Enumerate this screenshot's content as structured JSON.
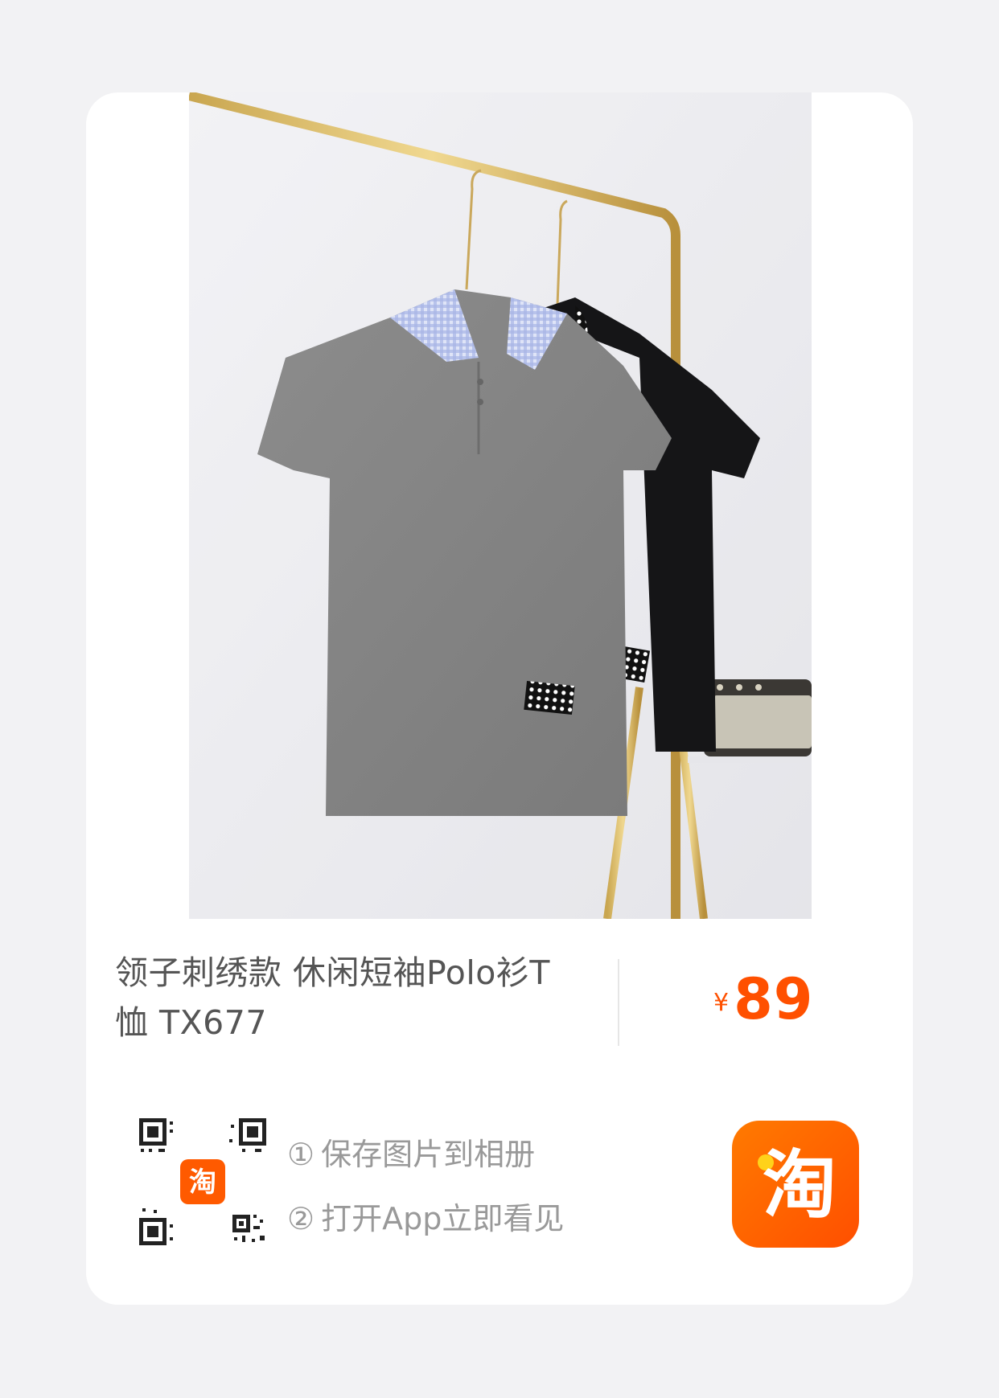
{
  "product": {
    "title": "领子刺绣款 休闲短袖Polo衫T恤 TX677",
    "image_alt": "grey and black polo shirts on hanger"
  },
  "price": {
    "currency": "¥",
    "amount": "89"
  },
  "instructions": {
    "step1_num": "①",
    "step1_text": "保存图片到相册",
    "step2_num": "②",
    "step2_text": "打开App立即看见"
  },
  "qr_badge": {
    "text": "淘"
  },
  "taobao_logo": {
    "text": "淘"
  },
  "colors": {
    "accent": "#ff5000",
    "logo_gradient_start": "#ff7a00",
    "logo_gradient_end": "#ff4f00"
  }
}
